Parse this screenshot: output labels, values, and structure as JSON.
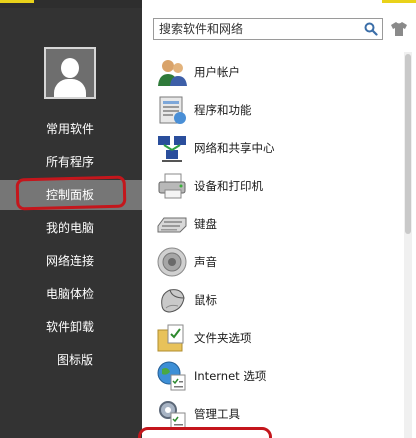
{
  "sidebar": {
    "items": [
      {
        "label": "常用软件"
      },
      {
        "label": "所有程序"
      },
      {
        "label": "控制面板"
      },
      {
        "label": "我的电脑"
      },
      {
        "label": "网络连接"
      },
      {
        "label": "电脑体检"
      },
      {
        "label": "软件卸载"
      },
      {
        "label": "图标版"
      }
    ],
    "active_index": 2
  },
  "search": {
    "placeholder": "搜索软件和网络"
  },
  "control_panel": {
    "items": [
      {
        "label": "用户帐户",
        "icon": "users-icon"
      },
      {
        "label": "程序和功能",
        "icon": "programs-features-icon"
      },
      {
        "label": "网络和共享中心",
        "icon": "network-sharing-icon"
      },
      {
        "label": "设备和打印机",
        "icon": "printer-icon"
      },
      {
        "label": "键盘",
        "icon": "keyboard-icon"
      },
      {
        "label": "声音",
        "icon": "speaker-icon"
      },
      {
        "label": "鼠标",
        "icon": "mouse-icon"
      },
      {
        "label": "文件夹选项",
        "icon": "folder-options-icon"
      },
      {
        "label": "Internet 选项",
        "icon": "internet-options-icon"
      },
      {
        "label": "管理工具",
        "icon": "admin-tools-icon"
      }
    ]
  },
  "colors": {
    "sidebar_bg": "#333333",
    "active_item_bg": "#767676",
    "annotation_red": "#c4161c",
    "accent_yellow": "#e9d21a"
  }
}
